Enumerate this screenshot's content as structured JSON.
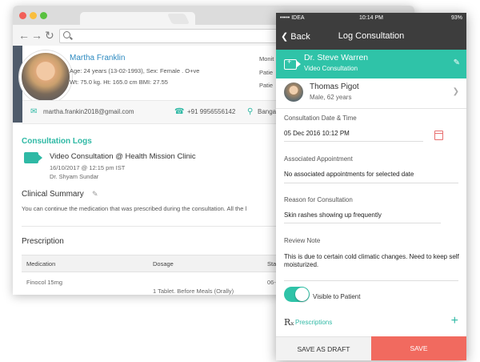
{
  "browser": {
    "patient": {
      "name": "Martha Franklin",
      "age_line": "Age: 24 years (13-02-1993), Sex: Female . O+ve",
      "vitals_line": "Wt: 75.0 kg. Ht: 165.0 cm BMI: 27.55",
      "right_labels": [
        "Monit",
        "Patie",
        "Patie"
      ]
    },
    "contact": {
      "email": "martha.frankin2018@gmail.com",
      "phone": "+91 9956556142",
      "location": "Bangalore"
    },
    "consultation_logs": {
      "title": "Consultation Logs",
      "item_title": "Video Consultation @ Health Mission Clinic",
      "item_date": "16/10/2017 @ 12:15 pm IST",
      "item_doctor": "Dr. Shyam Sundar"
    },
    "clinical_summary": {
      "title": "Clinical Summary",
      "text": "You can continue the medication that was prescribed during the consultation. All the l"
    },
    "prescription": {
      "title": "Prescription",
      "headers": [
        "Medication",
        "Dosage",
        "Sta"
      ],
      "rows": [
        {
          "medication": "Finocol 15mg",
          "dosage": "1 Tablet. Before Meals (Orally)",
          "start": "06-"
        }
      ]
    }
  },
  "phone": {
    "status": {
      "carrier": "••••• IDEA",
      "time": "10:14 PM",
      "battery": "93%"
    },
    "nav": {
      "back": "Back",
      "title": "Log Consultation"
    },
    "doctor": {
      "name": "Dr. Steve Warren",
      "type": "Video Consultation"
    },
    "patient": {
      "name": "Thomas Pigot",
      "info": "Male, 62 years"
    },
    "fields": {
      "date_label": "Consultation Date & Time",
      "date_value": "05 Dec 2016 10:12 PM",
      "appointment_label": "Associated Appointment",
      "appointment_value": "No associated appointments for selected date",
      "reason_label": "Reason for Consultation",
      "reason_value": "Skin rashes showing up frequently",
      "review_label": "Review Note",
      "review_value": "This is due to certain cold climatic changes. Need to keep self moisturized."
    },
    "visible_to_patient": {
      "label": "Visible to Patient",
      "on": true
    },
    "prescriptions_label": "Prescriptions",
    "buttons": {
      "draft": "SAVE AS DRAFT",
      "save": "SAVE"
    }
  },
  "colors": {
    "accent": "#2fc3a8",
    "dark": "#3d3d3d",
    "save": "#f16a5f",
    "link": "#2d8ac0"
  }
}
